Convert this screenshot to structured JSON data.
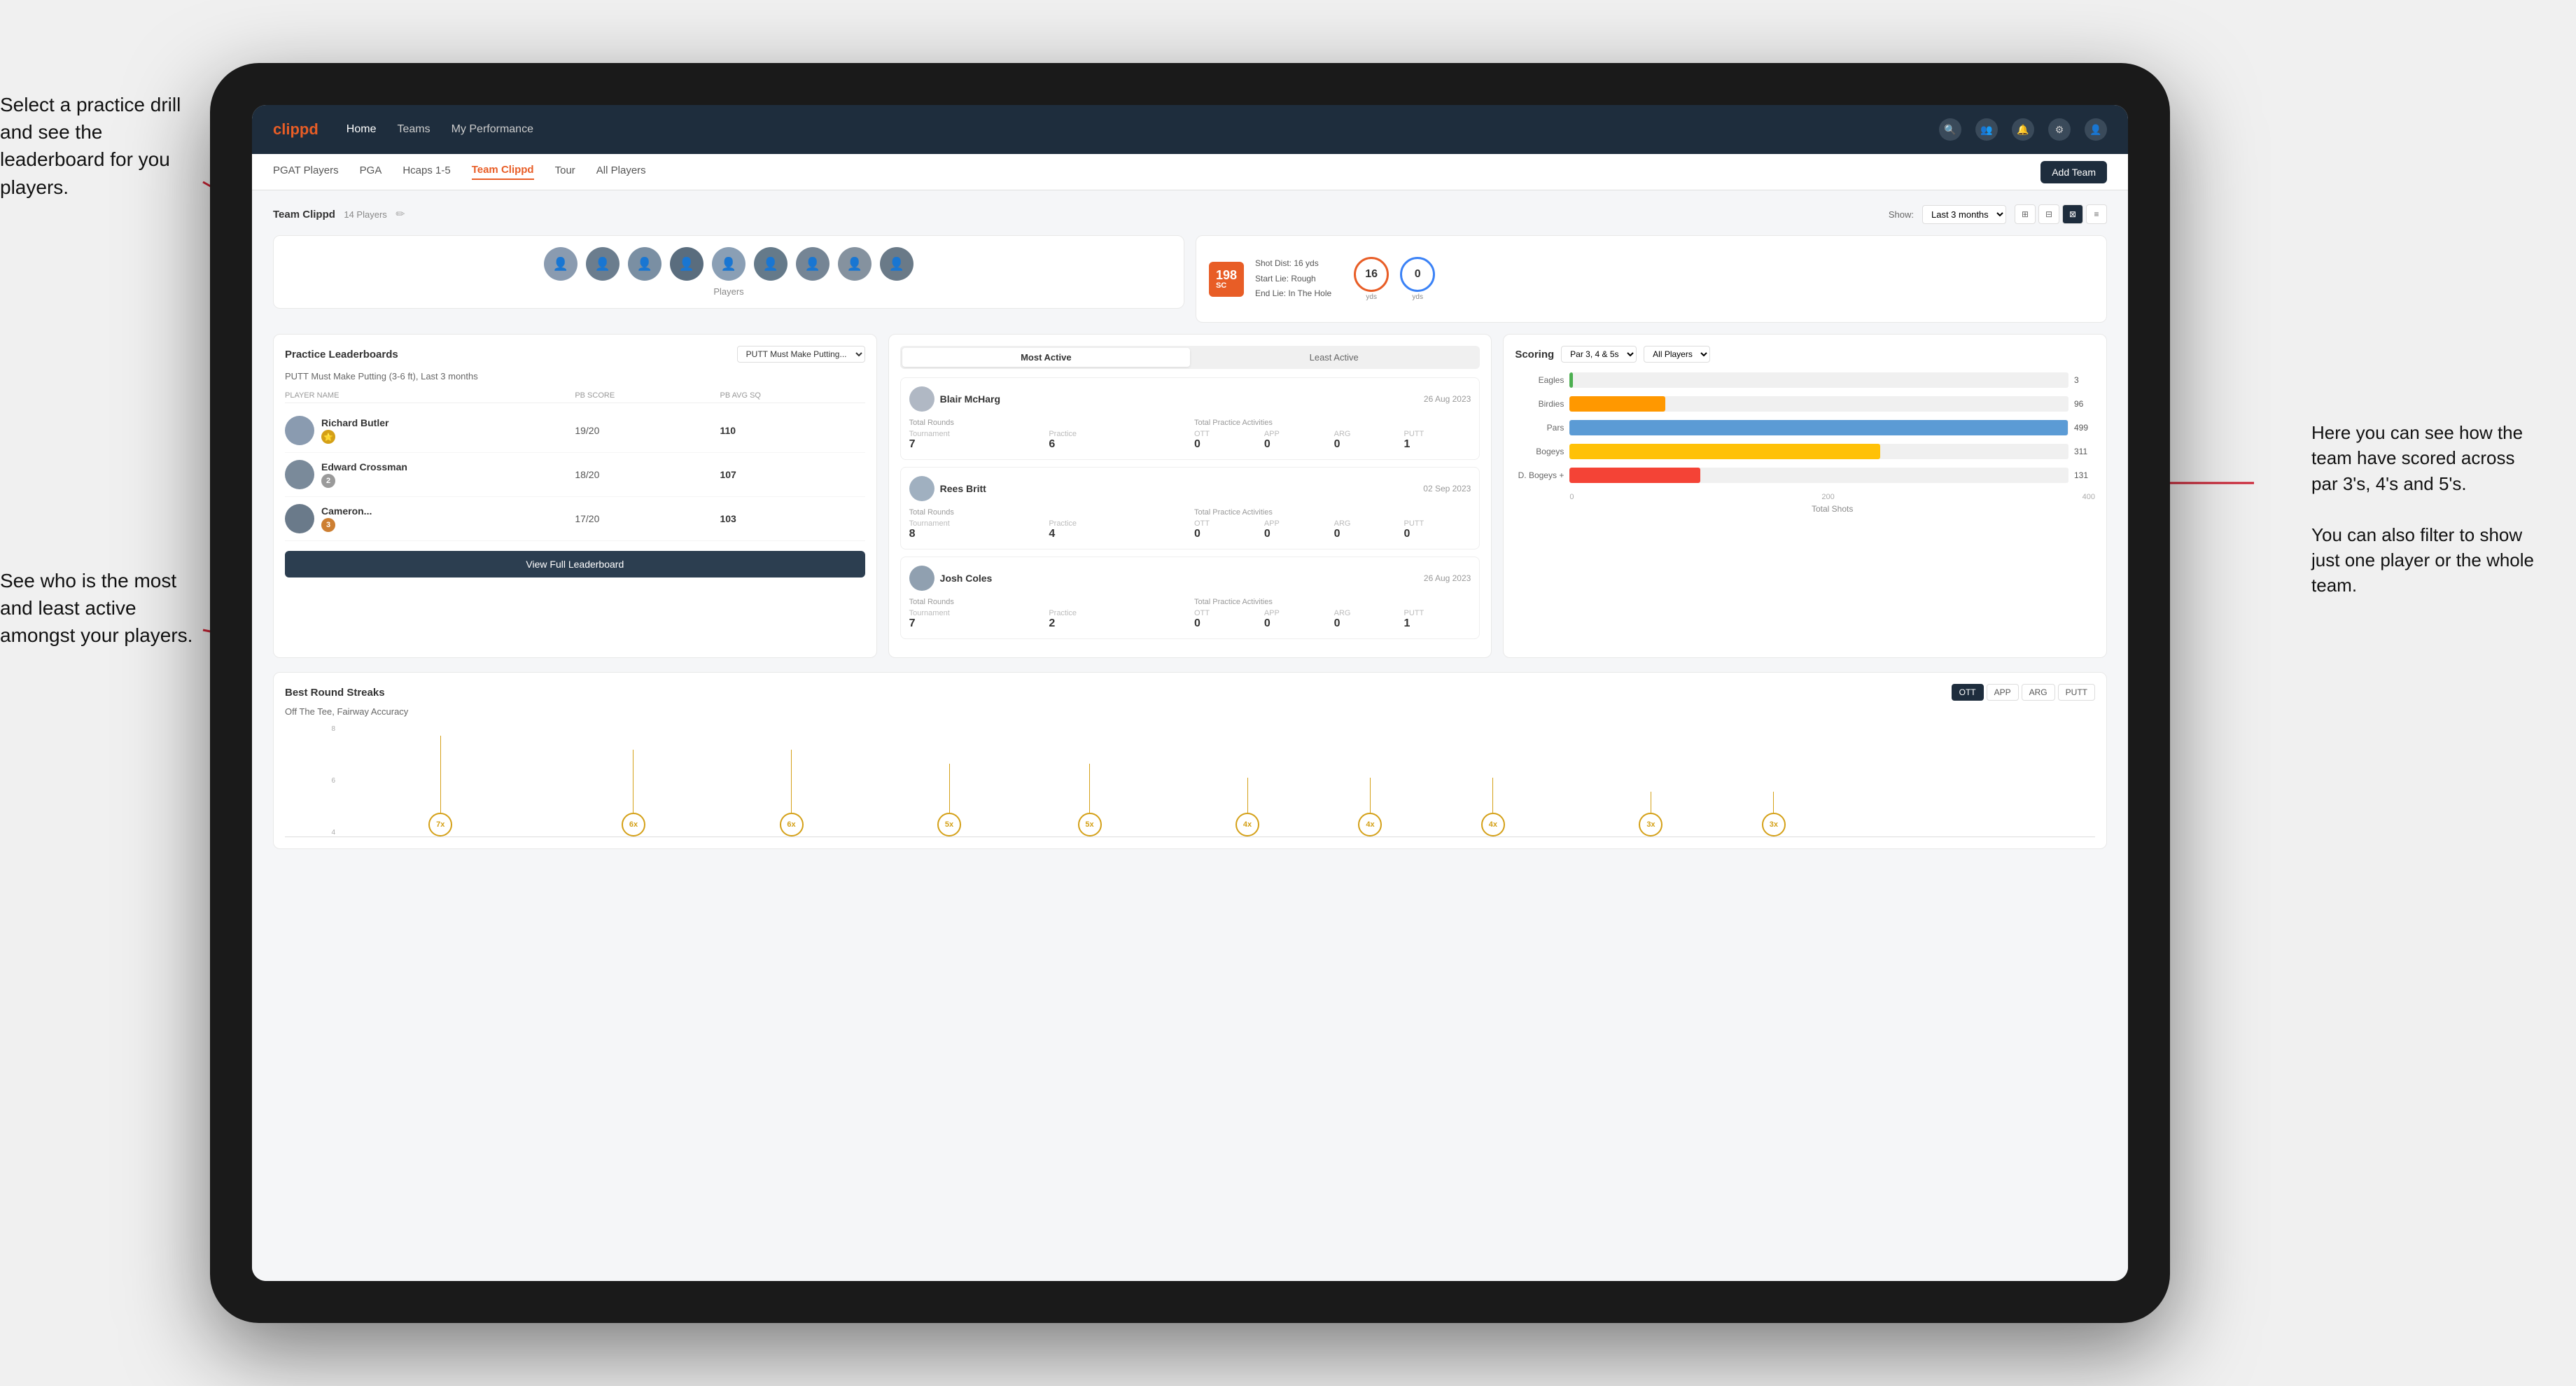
{
  "annotations": {
    "top_left": "Select a practice drill and see\nthe leaderboard for you players.",
    "bottom_left": "See who is the most and least\nactive amongst your players.",
    "right": "Here you can see how the\nteam have scored across\npar 3's, 4's and 5's.\n\nYou can also filter to show\njust one player or the whole\nteam."
  },
  "nav": {
    "logo": "clippd",
    "links": [
      "Home",
      "Teams",
      "My Performance"
    ],
    "icons": [
      "search",
      "people",
      "bell",
      "settings",
      "user"
    ]
  },
  "sub_nav": {
    "links": [
      "PGAT Players",
      "PGA",
      "Hcaps 1-5",
      "Team Clippd",
      "Tour",
      "All Players"
    ],
    "active": "Team Clippd",
    "add_team_btn": "Add Team"
  },
  "team_header": {
    "title": "Team Clippd",
    "player_count": "14 Players",
    "show_label": "Show:",
    "show_value": "Last 3 months",
    "view_modes": [
      "grid-small",
      "grid-large",
      "grid-active",
      "list"
    ]
  },
  "players": {
    "label": "Players",
    "count": 9
  },
  "shot_card": {
    "number": "198",
    "suffix": "SC",
    "info_lines": [
      "Shot Dist: 16 yds",
      "Start Lie: Rough",
      "End Lie: In The Hole"
    ],
    "metric1_val": "16",
    "metric1_label": "yds",
    "metric2_val": "0",
    "metric2_label": "yds"
  },
  "practice_leaderboard": {
    "title": "Practice Leaderboards",
    "select": "PUTT Must Make Putting...",
    "subtitle": "PUTT Must Make Putting (3-6 ft), Last 3 months",
    "columns": [
      "PLAYER NAME",
      "PB SCORE",
      "PB AVG SQ"
    ],
    "rows": [
      {
        "name": "Richard Butler",
        "score": "19/20",
        "avg": "110",
        "badge": "1",
        "badge_type": "gold"
      },
      {
        "name": "Edward Crossman",
        "score": "18/20",
        "avg": "107",
        "badge": "2",
        "badge_type": "silver"
      },
      {
        "name": "Cameron...",
        "score": "17/20",
        "avg": "103",
        "badge": "3",
        "badge_type": "bronze"
      }
    ],
    "view_full_btn": "View Full Leaderboard"
  },
  "activity": {
    "tabs": [
      "Most Active",
      "Least Active"
    ],
    "active_tab": "Most Active",
    "players": [
      {
        "name": "Blair McHarg",
        "date": "26 Aug 2023",
        "total_rounds_label": "Total Rounds",
        "tournament_label": "Tournament",
        "practice_label": "Practice",
        "tournament_val": "7",
        "practice_val": "6",
        "practice_activities_label": "Total Practice Activities",
        "ott_label": "OTT",
        "app_label": "APP",
        "arg_label": "ARG",
        "putt_label": "PUTT",
        "ott_val": "0",
        "app_val": "0",
        "arg_val": "0",
        "putt_val": "1"
      },
      {
        "name": "Rees Britt",
        "date": "02 Sep 2023",
        "total_rounds_label": "Total Rounds",
        "tournament_label": "Tournament",
        "practice_label": "Practice",
        "tournament_val": "8",
        "practice_val": "4",
        "practice_activities_label": "Total Practice Activities",
        "ott_label": "OTT",
        "app_label": "APP",
        "arg_label": "ARG",
        "putt_label": "PUTT",
        "ott_val": "0",
        "app_val": "0",
        "arg_val": "0",
        "putt_val": "0"
      },
      {
        "name": "Josh Coles",
        "date": "26 Aug 2023",
        "total_rounds_label": "Total Rounds",
        "tournament_label": "Tournament",
        "practice_label": "Practice",
        "tournament_val": "7",
        "practice_val": "2",
        "practice_activities_label": "Total Practice Activities",
        "ott_label": "OTT",
        "app_label": "APP",
        "arg_label": "ARG",
        "putt_label": "PUTT",
        "ott_val": "0",
        "app_val": "0",
        "arg_val": "0",
        "putt_val": "1"
      }
    ]
  },
  "scoring": {
    "title": "Scoring",
    "filter1_label": "Par 3, 4 & 5s",
    "filter2_label": "All Players",
    "bars": [
      {
        "label": "Eagles",
        "value": 3,
        "max": 500,
        "color": "green",
        "display": "3"
      },
      {
        "label": "Birdies",
        "value": 96,
        "max": 500,
        "color": "orange",
        "display": "96"
      },
      {
        "label": "Pars",
        "value": 499,
        "max": 500,
        "color": "blue",
        "display": "499"
      },
      {
        "label": "Bogeys",
        "value": 311,
        "max": 500,
        "color": "yellow",
        "display": "311"
      },
      {
        "label": "D. Bogeys +",
        "value": 131,
        "max": 500,
        "color": "red",
        "display": "131"
      }
    ],
    "x_labels": [
      "0",
      "200",
      "400"
    ],
    "x_title": "Total Shots"
  },
  "streaks": {
    "title": "Best Round Streaks",
    "buttons": [
      "OTT",
      "APP",
      "ARG",
      "PUTT"
    ],
    "active_btn": "OTT",
    "subtitle": "Off The Tee, Fairway Accuracy",
    "dots": [
      {
        "label": "7x",
        "left_pct": 5,
        "height": 110
      },
      {
        "label": "6x",
        "left_pct": 15,
        "height": 90
      },
      {
        "label": "6x",
        "left_pct": 24,
        "height": 90
      },
      {
        "label": "5x",
        "left_pct": 34,
        "height": 70
      },
      {
        "label": "5x",
        "left_pct": 41,
        "height": 70
      },
      {
        "label": "4x",
        "left_pct": 50,
        "height": 50
      },
      {
        "label": "4x",
        "left_pct": 57,
        "height": 50
      },
      {
        "label": "4x",
        "left_pct": 64,
        "height": 50
      },
      {
        "label": "3x",
        "left_pct": 73,
        "height": 30
      },
      {
        "label": "3x",
        "left_pct": 80,
        "height": 30
      }
    ]
  }
}
